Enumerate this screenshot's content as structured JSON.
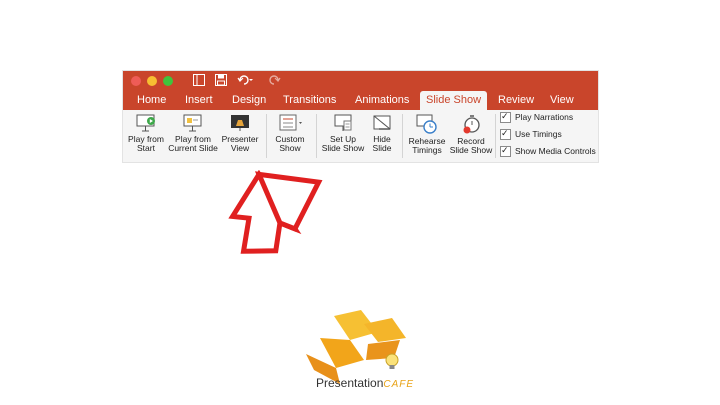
{
  "ribbon": {
    "tabs": [
      {
        "label": "Home"
      },
      {
        "label": "Insert"
      },
      {
        "label": "Design"
      },
      {
        "label": "Transitions"
      },
      {
        "label": "Animations"
      },
      {
        "label": "Slide Show",
        "active": true
      },
      {
        "label": "Review"
      },
      {
        "label": "View"
      }
    ],
    "tools": {
      "play_from_start": {
        "line1": "Play from",
        "line2": "Start"
      },
      "play_current": {
        "line1": "Play from",
        "line2": "Current Slide"
      },
      "presenter_view": {
        "line1": "Presenter",
        "line2": "View"
      },
      "custom_show": {
        "line1": "Custom",
        "line2": "Show"
      },
      "setup_show": {
        "line1": "Set Up",
        "line2": "Slide Show"
      },
      "hide_slide": {
        "line1": "Hide",
        "line2": "Slide"
      },
      "rehearse": {
        "line1": "Rehearse",
        "line2": "Timings"
      },
      "record": {
        "line1": "Record",
        "line2": "Slide Show"
      }
    },
    "checkboxes": [
      {
        "label": "Play Narrations",
        "checked": true
      },
      {
        "label": "Use Timings",
        "checked": true
      },
      {
        "label": "Show Media Controls",
        "checked": true
      }
    ]
  },
  "colors": {
    "accent": "#c9452b",
    "arrow": "#e02020",
    "logo": "#f2a51a"
  },
  "logo": {
    "word": "Presentation",
    "suffix": "CAFE"
  }
}
